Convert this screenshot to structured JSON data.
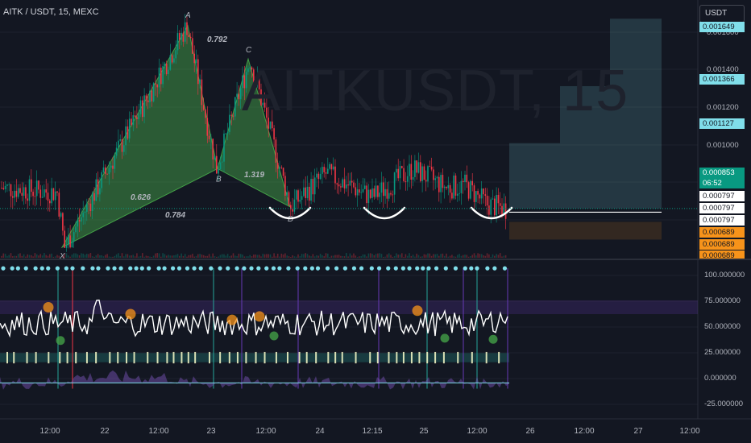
{
  "symbol_title": "AITK / USDT, 15, MEXC",
  "watermark": "AITKUSDT, 15",
  "currency_button": "USDT",
  "price_axis": [
    "0.001600",
    "0.001400",
    "0.001200",
    "0.001000"
  ],
  "price_tags": [
    {
      "text": "0.001649",
      "bg": "#80deea",
      "fg": "#131722"
    },
    {
      "text": "0.001366",
      "bg": "#80deea",
      "fg": "#131722"
    },
    {
      "text": "0.001127",
      "bg": "#80deea",
      "fg": "#131722"
    },
    {
      "text": "0.000853",
      "bg": "#089981",
      "fg": "#ffffff"
    },
    {
      "text": "06:52",
      "bg": "#089981",
      "fg": "#ffffff"
    },
    {
      "text": "0.000797",
      "bg": "#ffffff",
      "fg": "#131722"
    },
    {
      "text": "0.000797",
      "bg": "#ffffff",
      "fg": "#131722"
    },
    {
      "text": "0.000797",
      "bg": "#ffffff",
      "fg": "#131722"
    },
    {
      "text": "0.000689",
      "bg": "#f7931a",
      "fg": "#131722"
    },
    {
      "text": "0.000689",
      "bg": "#f7931a",
      "fg": "#131722"
    },
    {
      "text": "0.000689",
      "bg": "#f7931a",
      "fg": "#131722"
    }
  ],
  "oscillator_axis": [
    "100.000000",
    "75.000000",
    "50.000000",
    "25.000000",
    "0.000000",
    "-25.000000"
  ],
  "time_axis": [
    "12:00",
    "22",
    "12:00",
    "23",
    "12:00",
    "24",
    "12:15",
    "25",
    "12:00",
    "26",
    "12:00",
    "27",
    "12:00"
  ],
  "chart_data": {
    "type": "candlestick",
    "pattern_points": [
      {
        "label": "X",
        "price": 0.00069
      },
      {
        "label": "A",
        "price": 0.00162
      },
      {
        "label": "B",
        "price": 0.00102
      },
      {
        "label": "C",
        "price": 0.00148
      },
      {
        "label": "D",
        "price": 0.00086
      }
    ],
    "pattern_ratios": [
      "0.792",
      "0.626",
      "1.319",
      "0.784"
    ],
    "targets": [
      0.001127,
      0.001366,
      0.001649
    ],
    "last_price": 0.000853,
    "support_levels": [
      0.000797,
      0.000689
    ],
    "price_ylim": [
      0.00066,
      0.00168
    ],
    "oscillator_ylim": [
      -30,
      105
    ],
    "oscillator_last": 58,
    "colors": {
      "up": "#089981",
      "down": "#f23645",
      "pattern": "#43a047",
      "target": "#80deea"
    }
  }
}
